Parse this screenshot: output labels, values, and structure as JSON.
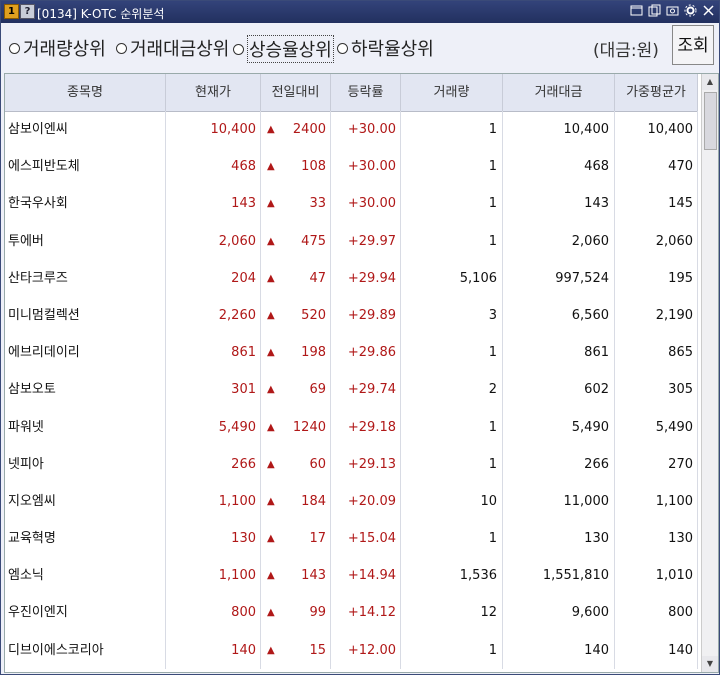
{
  "titlebar": {
    "badge1": "1",
    "badge2": "?",
    "title": "[0134] K-OTC 순위분석"
  },
  "options": [
    {
      "label": "거래량상위",
      "selected": false
    },
    {
      "label": "거래대금상위",
      "selected": false
    },
    {
      "label": "상승율상위",
      "selected": true
    },
    {
      "label": "하락율상위",
      "selected": false
    }
  ],
  "unit_label": "(대금:원)",
  "query_button": "조회",
  "columns": [
    "종목명",
    "현재가",
    "전일대비",
    "등락률",
    "거래량",
    "거래대금",
    "가중평균가"
  ],
  "rows": [
    {
      "name": "삼보이엔씨",
      "price": "10,400",
      "change": "2400",
      "rate": "+30.00",
      "volume": "1",
      "amount": "10,400",
      "avg": "10,400"
    },
    {
      "name": "에스피반도체",
      "price": "468",
      "change": "108",
      "rate": "+30.00",
      "volume": "1",
      "amount": "468",
      "avg": "470"
    },
    {
      "name": "한국우사회",
      "price": "143",
      "change": "33",
      "rate": "+30.00",
      "volume": "1",
      "amount": "143",
      "avg": "145"
    },
    {
      "name": "투에버",
      "price": "2,060",
      "change": "475",
      "rate": "+29.97",
      "volume": "1",
      "amount": "2,060",
      "avg": "2,060"
    },
    {
      "name": "산타크루즈",
      "price": "204",
      "change": "47",
      "rate": "+29.94",
      "volume": "5,106",
      "amount": "997,524",
      "avg": "195"
    },
    {
      "name": "미니멈컬렉션",
      "price": "2,260",
      "change": "520",
      "rate": "+29.89",
      "volume": "3",
      "amount": "6,560",
      "avg": "2,190"
    },
    {
      "name": "에브리데이리",
      "price": "861",
      "change": "198",
      "rate": "+29.86",
      "volume": "1",
      "amount": "861",
      "avg": "865"
    },
    {
      "name": "삼보오토",
      "price": "301",
      "change": "69",
      "rate": "+29.74",
      "volume": "2",
      "amount": "602",
      "avg": "305"
    },
    {
      "name": "파워넷",
      "price": "5,490",
      "change": "1240",
      "rate": "+29.18",
      "volume": "1",
      "amount": "5,490",
      "avg": "5,490"
    },
    {
      "name": "넷피아",
      "price": "266",
      "change": "60",
      "rate": "+29.13",
      "volume": "1",
      "amount": "266",
      "avg": "270"
    },
    {
      "name": "지오엠씨",
      "price": "1,100",
      "change": "184",
      "rate": "+20.09",
      "volume": "10",
      "amount": "11,000",
      "avg": "1,100"
    },
    {
      "name": "교육혁명",
      "price": "130",
      "change": "17",
      "rate": "+15.04",
      "volume": "1",
      "amount": "130",
      "avg": "130"
    },
    {
      "name": "엠소닉",
      "price": "1,100",
      "change": "143",
      "rate": "+14.94",
      "volume": "1,536",
      "amount": "1,551,810",
      "avg": "1,010"
    },
    {
      "name": "우진이엔지",
      "price": "800",
      "change": "99",
      "rate": "+14.12",
      "volume": "12",
      "amount": "9,600",
      "avg": "800"
    },
    {
      "name": "디브이에스코리아",
      "price": "140",
      "change": "15",
      "rate": "+12.00",
      "volume": "1",
      "amount": "140",
      "avg": "140"
    }
  ],
  "arrow_symbol": "▲",
  "colors": {
    "up": "#b01818",
    "titlebar": "#2a3868"
  },
  "icons": [
    "window-icon",
    "copy-icon",
    "camera-icon",
    "settings-icon",
    "close-icon"
  ]
}
